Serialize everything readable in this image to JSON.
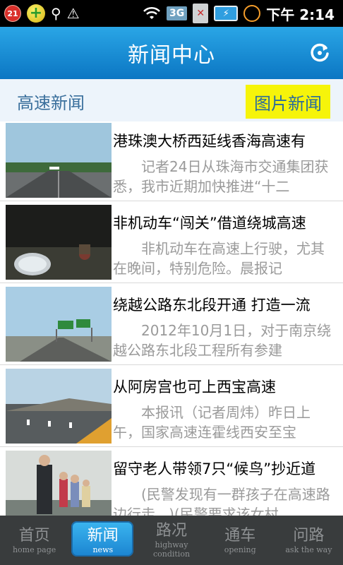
{
  "status_bar": {
    "notification_count": "21",
    "network": "3G",
    "time": "下午 2:14"
  },
  "header": {
    "title": "新闻中心"
  },
  "tabs": {
    "left": "高速新闻",
    "right": "图片新闻"
  },
  "news": [
    {
      "headline": "港珠澳大桥西延线香海高速有",
      "summary": "记者24日从珠海市交通集团获悉，我市近期加快推进“十二"
    },
    {
      "headline": "非机动车“闯关”借道绕城高速",
      "summary": "非机动车在高速上行驶，尤其在晚间，特别危险。晨报记"
    },
    {
      "headline": "绕越公路东北段开通 打造一流",
      "summary": "2012年10月1日，对于南京绕越公路东北段工程所有参建"
    },
    {
      "headline": "从阿房宫也可上西宝高速",
      "summary": "本报讯（记者周炜）昨日上午，国家高速连霍线西安至宝"
    },
    {
      "headline": "留守老人带领7只“候鸟”抄近道",
      "summary": "(民警发现有一群孩子在高速路边行走...)(民警要求该女村"
    }
  ],
  "bottom_nav": [
    {
      "cn": "首页",
      "en": "home page"
    },
    {
      "cn": "新闻",
      "en": "news"
    },
    {
      "cn": "路况",
      "en": "highway condition"
    },
    {
      "cn": "通车",
      "en": "opening"
    },
    {
      "cn": "问路",
      "en": "ask the way"
    }
  ],
  "colors": {
    "header_blue": "#1a8fd6",
    "tab_highlight": "#f6f40a",
    "nav_bg": "#393c3d",
    "nav_active": "#2aa2e6"
  }
}
